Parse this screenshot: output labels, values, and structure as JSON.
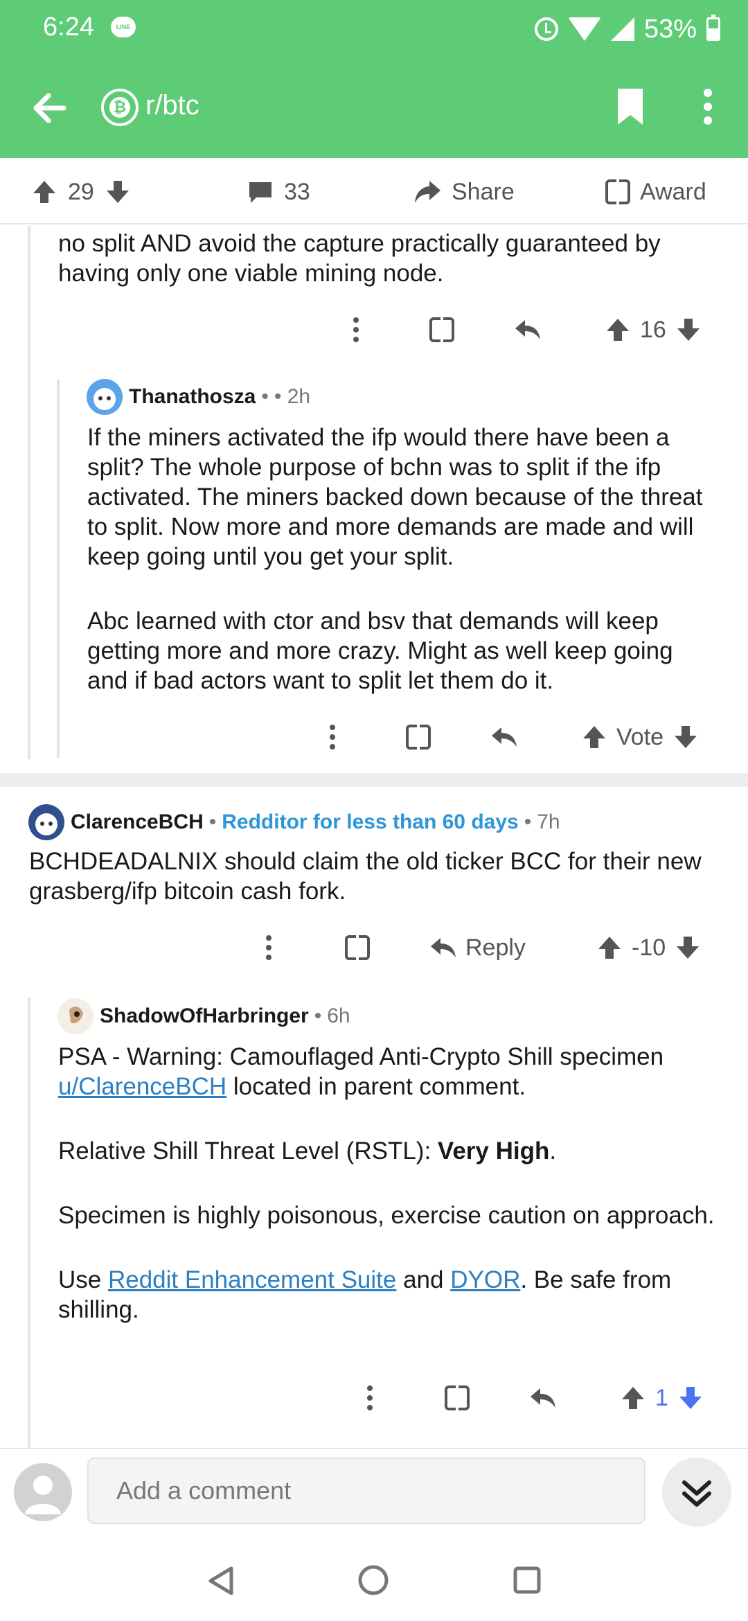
{
  "status_bar": {
    "time": "6:24",
    "line_badge": "LINE",
    "battery": "53%"
  },
  "app_bar": {
    "subreddit": "r/btc",
    "subreddit_icon": "₿"
  },
  "post_bar": {
    "upvotes": "29",
    "comments": "33",
    "share_label": "Share",
    "award_label": "Award"
  },
  "comments": [
    {
      "text_lines": [
        "no split AND avoid the capture practically guaranteed by having only one viable mining node."
      ],
      "score": "16"
    },
    {
      "author": "Thanathosza",
      "meta_sep": "•",
      "time": "• 2h",
      "paragraphs": [
        "If the miners activated the ifp would there have been a split? The whole purpose of bchn was to split if the ifp activated. The miners backed down because of the threat to split. Now more and more demands are made and will keep going until you get your split.",
        "Abc learned with ctor and bsv that demands will keep getting more and more crazy. Might as well keep going and if bad actors want to split let them do it."
      ],
      "score": "Vote"
    },
    {
      "author": "ClarenceBCH",
      "flair": "Redditor for less than 60 days",
      "time": "7h",
      "paragraphs": [
        "BCHDEADALNIX should claim the old ticker BCC for their new grasberg/ifp bitcoin cash fork."
      ],
      "reply_label": "Reply",
      "score": "-10"
    },
    {
      "author": "ShadowOfHarbringer",
      "time": "6h",
      "p1_before": "PSA - Warning: Camouflaged Anti-Crypto Shill specimen ",
      "p1_link": "u/ClarenceBCH",
      "p1_after": " located in parent comment.",
      "p2_before": "Relative Shill Threat Level (RSTL): ",
      "p2_bold": "Very High",
      "p2_after": ".",
      "p3": "Specimen is highly poisonous, exercise caution on approach.",
      "p4_before": "Use ",
      "p4_link1": "Reddit Enhancement Suite",
      "p4_mid": " and ",
      "p4_link2": "DYOR",
      "p4_after": ". Be safe from shilling.",
      "score": "1"
    }
  ],
  "bottom_bar": {
    "placeholder": "Add a comment"
  },
  "colors": {
    "header_green": "#5ecb76",
    "link_blue": "#2d7fc2",
    "flair_blue": "#2d96d8",
    "upvoted_blue": "#4a73f2"
  }
}
